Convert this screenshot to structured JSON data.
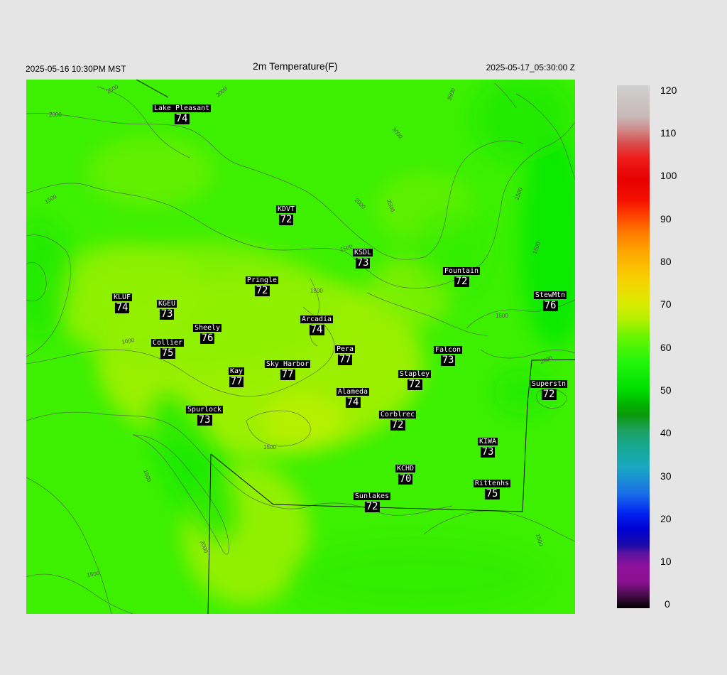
{
  "header": {
    "local_time": "2025-05-16 10:30PM MST",
    "title": "2m Temperature(F)",
    "valid_time": "2025-05-17_05:30:00 Z"
  },
  "stations": [
    {
      "name": "Lake Pleasant",
      "temp": "74"
    },
    {
      "name": "KDVT",
      "temp": "72"
    },
    {
      "name": "KSDL",
      "temp": "73"
    },
    {
      "name": "Fountain",
      "temp": "72"
    },
    {
      "name": "StewMtn",
      "temp": "76"
    },
    {
      "name": "Pringle",
      "temp": "72"
    },
    {
      "name": "KLUF",
      "temp": "74"
    },
    {
      "name": "KGEU",
      "temp": "73"
    },
    {
      "name": "Arcadia",
      "temp": "74"
    },
    {
      "name": "Sheely",
      "temp": "76"
    },
    {
      "name": "Collier",
      "temp": "75"
    },
    {
      "name": "Pera",
      "temp": "77"
    },
    {
      "name": "Falcon",
      "temp": "73"
    },
    {
      "name": "Sky Harbor",
      "temp": "77"
    },
    {
      "name": "Kay",
      "temp": "77"
    },
    {
      "name": "Stapley",
      "temp": "72"
    },
    {
      "name": "Superstn",
      "temp": "72"
    },
    {
      "name": "Alameda",
      "temp": "74"
    },
    {
      "name": "Spurlock",
      "temp": "73"
    },
    {
      "name": "Corblrec",
      "temp": "72"
    },
    {
      "name": "KIWA",
      "temp": "73"
    },
    {
      "name": "KCHD",
      "temp": "70"
    },
    {
      "name": "Rittenhs",
      "temp": "75"
    },
    {
      "name": "Sunlakes",
      "temp": "72"
    }
  ],
  "contour_labels": [
    "2500",
    "2000",
    "3500",
    "3000",
    "2000",
    "1500",
    "2500",
    "2500",
    "2000",
    "1500",
    "1500",
    "1500",
    "1000",
    "2000",
    "1500",
    "1500",
    "1500",
    "2000",
    "1500",
    "1500"
  ],
  "colorbar": {
    "units": "F",
    "ticks": [
      "120",
      "110",
      "100",
      "90",
      "80",
      "70",
      "60",
      "50",
      "40",
      "30",
      "20",
      "10",
      "0"
    ]
  },
  "colors": {
    "field_base": "#40f000",
    "field_warm": "#a8f000",
    "field_cool": "#00e800",
    "contour": "#555555",
    "station_box": "#000000",
    "station_text": "#ffffff"
  }
}
